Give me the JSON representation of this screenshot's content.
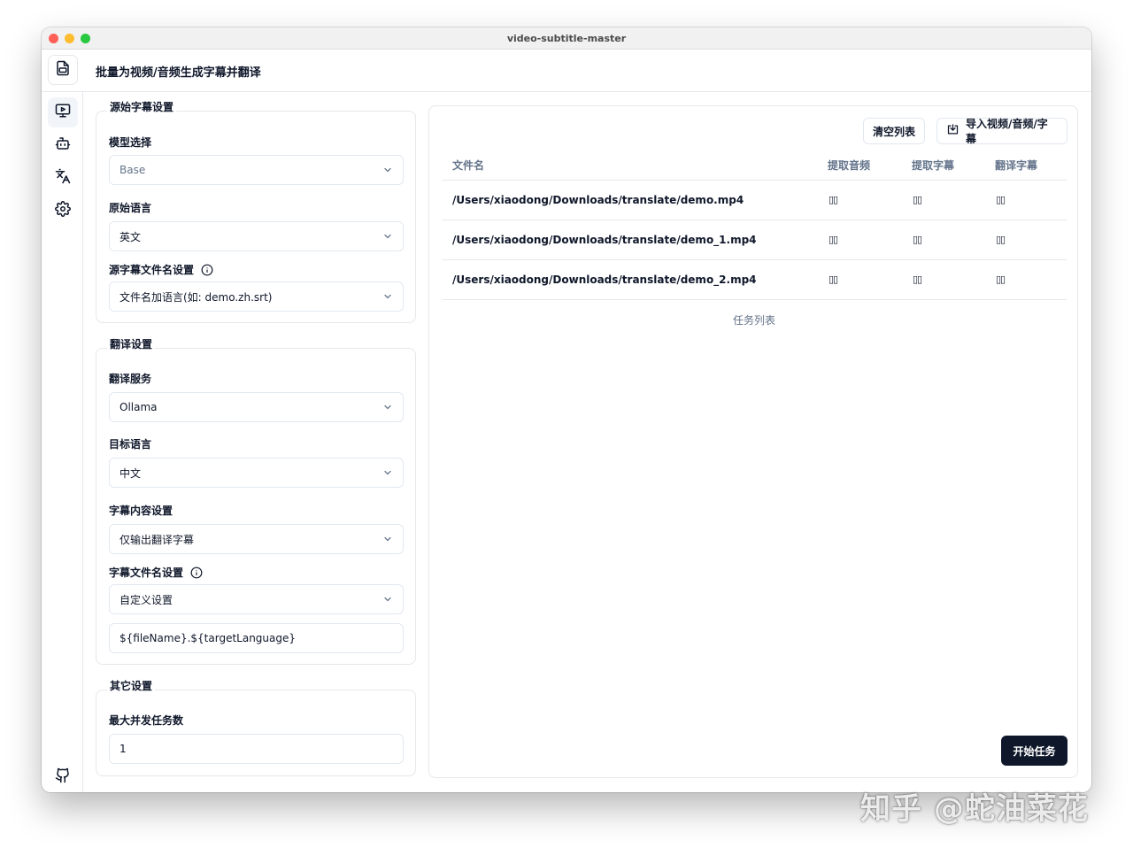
{
  "window": {
    "title": "video-subtitle-master"
  },
  "header": {
    "title": "批量为视频/音频生成字幕并翻译",
    "logo_icon": "file-subtitle-icon"
  },
  "sidebar": {
    "items": [
      {
        "icon": "monitor-play-icon",
        "active": true
      },
      {
        "icon": "bot-icon",
        "active": false
      },
      {
        "icon": "translate-icon",
        "active": false
      },
      {
        "icon": "gear-icon",
        "active": false
      }
    ],
    "bottom_icon": "github-icon"
  },
  "source_settings": {
    "title": "源始字幕设置",
    "model_label": "模型选择",
    "model_placeholder": "Base",
    "language_label": "原始语言",
    "language_value": "英文",
    "filename_label": "源字幕文件名设置",
    "filename_value": "文件名加语言(如: demo.zh.srt)"
  },
  "translate_settings": {
    "title": "翻译设置",
    "service_label": "翻译服务",
    "service_value": "Ollama",
    "target_label": "目标语言",
    "target_value": "中文",
    "content_label": "字幕内容设置",
    "content_value": "仅输出翻译字幕",
    "filename_label": "字幕文件名设置",
    "filename_value": "自定义设置",
    "template_value": "${fileName}.${targetLanguage}"
  },
  "other_settings": {
    "title": "其它设置",
    "concurrency_label": "最大并发任务数",
    "concurrency_value": "1"
  },
  "tasks": {
    "clear_button": "清空列表",
    "import_button": "导入视频/音频/字幕",
    "columns": [
      "文件名",
      "提取音频",
      "提取字幕",
      "翻译字幕"
    ],
    "rows": [
      {
        "file": "/Users/xiaodong/Downloads/translate/demo.mp4",
        "audio": "▯▯",
        "subtitle": "▯▯",
        "translate": "▯▯"
      },
      {
        "file": "/Users/xiaodong/Downloads/translate/demo_1.mp4",
        "audio": "▯▯",
        "subtitle": "▯▯",
        "translate": "▯▯"
      },
      {
        "file": "/Users/xiaodong/Downloads/translate/demo_2.mp4",
        "audio": "▯▯",
        "subtitle": "▯▯",
        "translate": "▯▯"
      }
    ],
    "caption": "任务列表",
    "start_button": "开始任务"
  },
  "watermark": "知乎 @蛇油菜花"
}
